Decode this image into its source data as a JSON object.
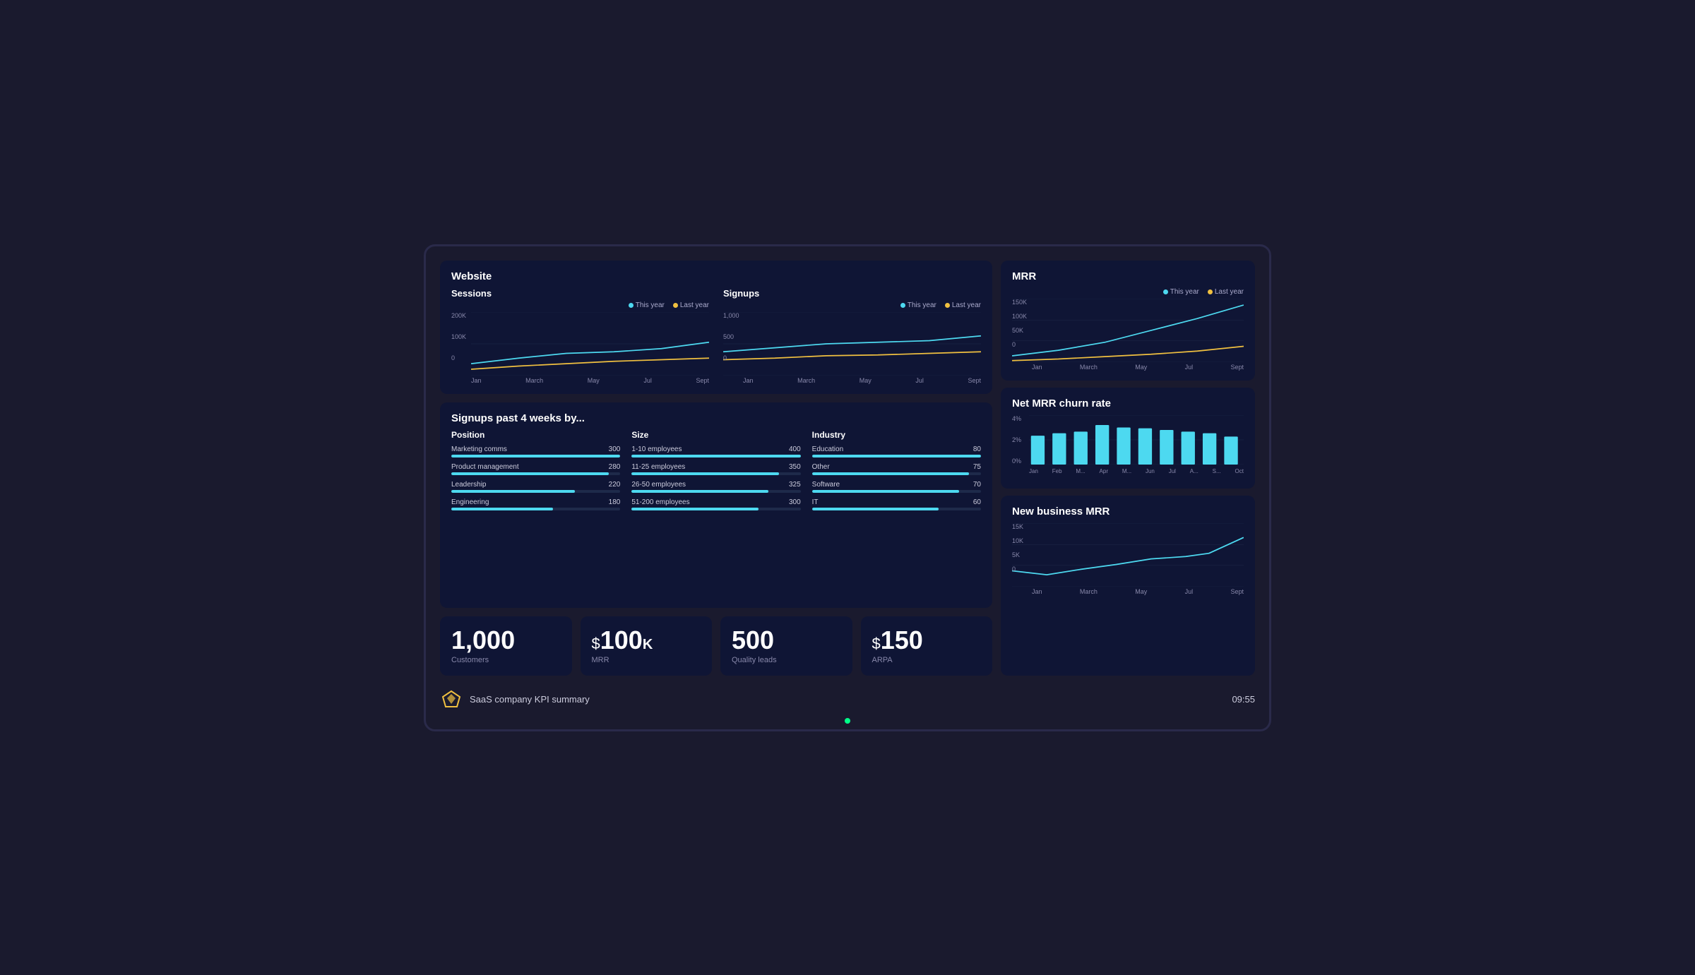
{
  "app": {
    "title": "SaaS company KPI summary",
    "time": "09:55"
  },
  "website": {
    "title": "Website",
    "sessions": {
      "label": "Sessions",
      "y_labels": [
        "200K",
        "100K",
        "0"
      ],
      "x_labels": [
        "Jan",
        "March",
        "May",
        "Jul",
        "Sept"
      ],
      "legend": {
        "this_year": "This year",
        "last_year": "Last year"
      }
    },
    "signups": {
      "label": "Signups",
      "y_labels": [
        "1,000",
        "500",
        "0"
      ],
      "x_labels": [
        "Jan",
        "March",
        "May",
        "Jul",
        "Sept"
      ],
      "legend": {
        "this_year": "This year",
        "last_year": "Last year"
      }
    }
  },
  "signups_section": {
    "title": "Signups past 4 weeks by...",
    "position": {
      "title": "Position",
      "items": [
        {
          "label": "Marketing comms",
          "value": 300,
          "pct": 100
        },
        {
          "label": "Product management",
          "value": 280,
          "pct": 93
        },
        {
          "label": "Leadership",
          "value": 220,
          "pct": 73
        },
        {
          "label": "Engineering",
          "value": 180,
          "pct": 60
        }
      ]
    },
    "size": {
      "title": "Size",
      "items": [
        {
          "label": "1-10 employees",
          "value": 400,
          "pct": 100
        },
        {
          "label": "11-25 employees",
          "value": 350,
          "pct": 87
        },
        {
          "label": "26-50 employees",
          "value": 325,
          "pct": 81
        },
        {
          "label": "51-200 employees",
          "value": 300,
          "pct": 75
        }
      ]
    },
    "industry": {
      "title": "Industry",
      "items": [
        {
          "label": "Education",
          "value": 80,
          "pct": 100
        },
        {
          "label": "Other",
          "value": 75,
          "pct": 93
        },
        {
          "label": "Software",
          "value": 70,
          "pct": 87
        },
        {
          "label": "IT",
          "value": 60,
          "pct": 75
        }
      ]
    }
  },
  "metrics": [
    {
      "big": "1,000",
      "label": "Customers",
      "prefix": ""
    },
    {
      "big": "100",
      "label": "MRR",
      "prefix": "$",
      "suffix": "K"
    },
    {
      "big": "500",
      "label": "Quality leads",
      "prefix": ""
    },
    {
      "big": "150",
      "label": "ARPA",
      "prefix": "$"
    }
  ],
  "mrr": {
    "title": "MRR",
    "y_labels": [
      "150K",
      "100K",
      "50K",
      "0"
    ],
    "x_labels": [
      "Jan",
      "March",
      "May",
      "Jul",
      "Sept"
    ],
    "legend": {
      "this_year": "This year",
      "last_year": "Last year"
    }
  },
  "net_mrr_churn": {
    "title": "Net MRR churn rate",
    "y_labels": [
      "4%",
      "2%",
      "0%"
    ],
    "x_labels": [
      "Jan",
      "Feb",
      "M...",
      "Apr",
      "M...",
      "Jun",
      "Jul",
      "A...",
      "S...",
      "Oct"
    ]
  },
  "new_business_mrr": {
    "title": "New business MRR",
    "y_labels": [
      "15K",
      "10K",
      "5K",
      "0"
    ],
    "x_labels": [
      "Jan",
      "March",
      "May",
      "Jul",
      "Sept"
    ]
  }
}
